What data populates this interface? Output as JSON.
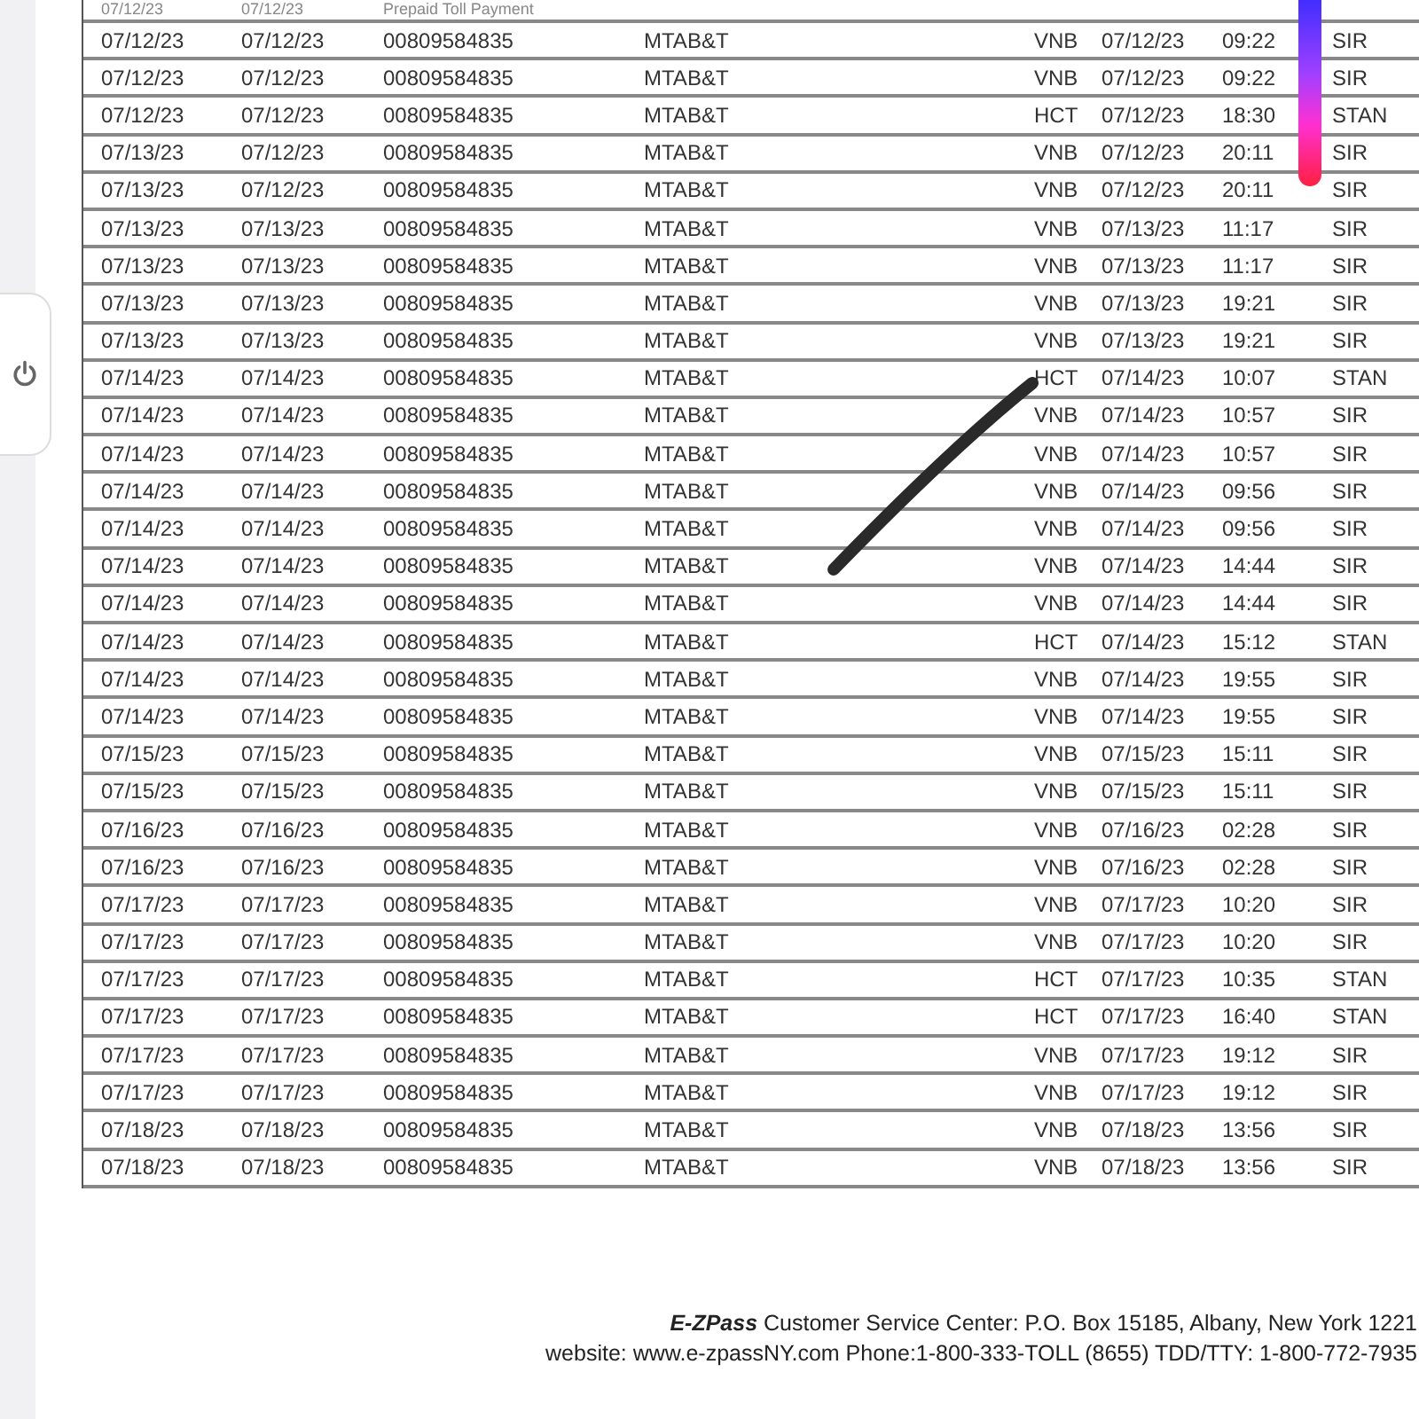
{
  "table": {
    "partial_row": [
      "07/12/23",
      "07/12/23",
      "Prepaid Toll Payment"
    ],
    "rows": [
      [
        "07/12/23",
        "07/12/23",
        "00809584835",
        "MTAB&T",
        "VNB",
        "07/12/23",
        "09:22",
        "SIR"
      ],
      [
        "07/12/23",
        "07/12/23",
        "00809584835",
        "MTAB&T",
        "VNB",
        "07/12/23",
        "09:22",
        "SIR"
      ],
      [
        "07/12/23",
        "07/12/23",
        "00809584835",
        "MTAB&T",
        "HCT",
        "07/12/23",
        "18:30",
        "STAN"
      ],
      [
        "07/13/23",
        "07/12/23",
        "00809584835",
        "MTAB&T",
        "VNB",
        "07/12/23",
        "20:11",
        "SIR"
      ],
      [
        "07/13/23",
        "07/12/23",
        "00809584835",
        "MTAB&T",
        "VNB",
        "07/12/23",
        "20:11",
        "SIR"
      ],
      [
        "07/13/23",
        "07/13/23",
        "00809584835",
        "MTAB&T",
        "VNB",
        "07/13/23",
        "11:17",
        "SIR"
      ],
      [
        "07/13/23",
        "07/13/23",
        "00809584835",
        "MTAB&T",
        "VNB",
        "07/13/23",
        "11:17",
        "SIR"
      ],
      [
        "07/13/23",
        "07/13/23",
        "00809584835",
        "MTAB&T",
        "VNB",
        "07/13/23",
        "19:21",
        "SIR"
      ],
      [
        "07/13/23",
        "07/13/23",
        "00809584835",
        "MTAB&T",
        "VNB",
        "07/13/23",
        "19:21",
        "SIR"
      ],
      [
        "07/14/23",
        "07/14/23",
        "00809584835",
        "MTAB&T",
        "HCT",
        "07/14/23",
        "10:07",
        "STAN"
      ],
      [
        "07/14/23",
        "07/14/23",
        "00809584835",
        "MTAB&T",
        "VNB",
        "07/14/23",
        "10:57",
        "SIR"
      ],
      [
        "07/14/23",
        "07/14/23",
        "00809584835",
        "MTAB&T",
        "VNB",
        "07/14/23",
        "10:57",
        "SIR"
      ],
      [
        "07/14/23",
        "07/14/23",
        "00809584835",
        "MTAB&T",
        "VNB",
        "07/14/23",
        "09:56",
        "SIR"
      ],
      [
        "07/14/23",
        "07/14/23",
        "00809584835",
        "MTAB&T",
        "VNB",
        "07/14/23",
        "09:56",
        "SIR"
      ],
      [
        "07/14/23",
        "07/14/23",
        "00809584835",
        "MTAB&T",
        "VNB",
        "07/14/23",
        "14:44",
        "SIR"
      ],
      [
        "07/14/23",
        "07/14/23",
        "00809584835",
        "MTAB&T",
        "VNB",
        "07/14/23",
        "14:44",
        "SIR"
      ],
      [
        "07/14/23",
        "07/14/23",
        "00809584835",
        "MTAB&T",
        "HCT",
        "07/14/23",
        "15:12",
        "STAN"
      ],
      [
        "07/14/23",
        "07/14/23",
        "00809584835",
        "MTAB&T",
        "VNB",
        "07/14/23",
        "19:55",
        "SIR"
      ],
      [
        "07/14/23",
        "07/14/23",
        "00809584835",
        "MTAB&T",
        "VNB",
        "07/14/23",
        "19:55",
        "SIR"
      ],
      [
        "07/15/23",
        "07/15/23",
        "00809584835",
        "MTAB&T",
        "VNB",
        "07/15/23",
        "15:11",
        "SIR"
      ],
      [
        "07/15/23",
        "07/15/23",
        "00809584835",
        "MTAB&T",
        "VNB",
        "07/15/23",
        "15:11",
        "SIR"
      ],
      [
        "07/16/23",
        "07/16/23",
        "00809584835",
        "MTAB&T",
        "VNB",
        "07/16/23",
        "02:28",
        "SIR"
      ],
      [
        "07/16/23",
        "07/16/23",
        "00809584835",
        "MTAB&T",
        "VNB",
        "07/16/23",
        "02:28",
        "SIR"
      ],
      [
        "07/17/23",
        "07/17/23",
        "00809584835",
        "MTAB&T",
        "VNB",
        "07/17/23",
        "10:20",
        "SIR"
      ],
      [
        "07/17/23",
        "07/17/23",
        "00809584835",
        "MTAB&T",
        "VNB",
        "07/17/23",
        "10:20",
        "SIR"
      ],
      [
        "07/17/23",
        "07/17/23",
        "00809584835",
        "MTAB&T",
        "HCT",
        "07/17/23",
        "10:35",
        "STAN"
      ],
      [
        "07/17/23",
        "07/17/23",
        "00809584835",
        "MTAB&T",
        "HCT",
        "07/17/23",
        "16:40",
        "STAN"
      ],
      [
        "07/17/23",
        "07/17/23",
        "00809584835",
        "MTAB&T",
        "VNB",
        "07/17/23",
        "19:12",
        "SIR"
      ],
      [
        "07/17/23",
        "07/17/23",
        "00809584835",
        "MTAB&T",
        "VNB",
        "07/17/23",
        "19:12",
        "SIR"
      ],
      [
        "07/18/23",
        "07/18/23",
        "00809584835",
        "MTAB&T",
        "VNB",
        "07/18/23",
        "13:56",
        "SIR"
      ],
      [
        "07/18/23",
        "07/18/23",
        "00809584835",
        "MTAB&T",
        "VNB",
        "07/18/23",
        "13:56",
        "SIR"
      ]
    ]
  },
  "footer": [
    "**E-ZPass** Customer Service Center: P.O. Box 15185, Albany, New York 1221",
    "website: www.e-zpassNY.com  Phone:1-800-333-TOLL (8655)  TDD/TTY: 1-800-772-7935"
  ]
}
